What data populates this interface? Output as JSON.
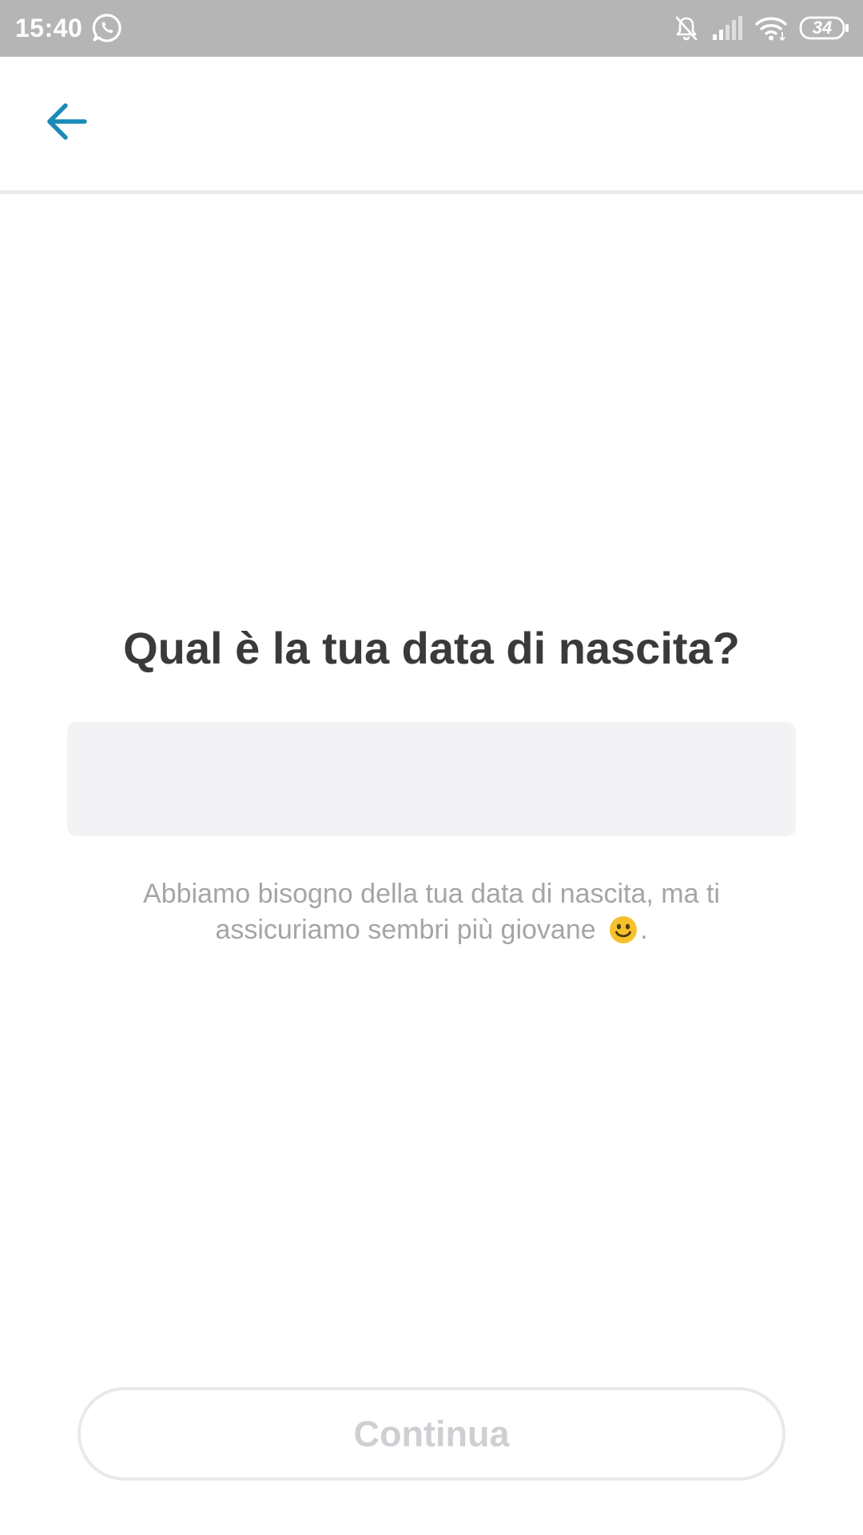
{
  "status_bar": {
    "time": "15:40",
    "battery": "34",
    "icons": [
      "whatsapp-icon",
      "bell-off-icon",
      "signal-icon",
      "wifi-icon",
      "battery-icon"
    ],
    "background_color": "#b5b5b5"
  },
  "app_bar": {
    "back_icon": "arrow-left-icon",
    "accent_color": "#1a8ab8"
  },
  "main": {
    "title": "Qual è la tua data di nascita?",
    "date_input": {
      "value": "",
      "placeholder": ""
    },
    "helper_text_before_emoji": "Abbiamo bisogno della tua data di nascita, ma ti assicuriamo sembri più giovane",
    "helper_text_after_emoji": ".",
    "helper_emoji": "smiley-icon"
  },
  "footer": {
    "continue_label": "Continua"
  }
}
